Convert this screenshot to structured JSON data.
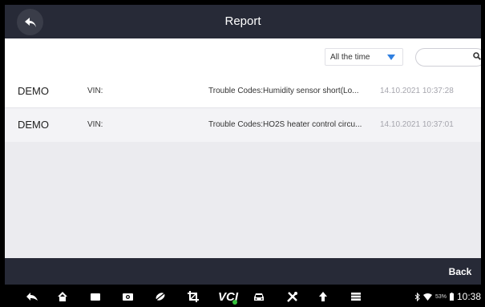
{
  "header": {
    "title": "Report"
  },
  "filter": {
    "period_selected": "All the time",
    "search_value": ""
  },
  "reports": [
    {
      "name": "DEMO",
      "vin": "VIN:",
      "codes": "Trouble Codes:Humidity sensor short(Lo...",
      "date": "14.10.2021 10:37:28"
    },
    {
      "name": "DEMO",
      "vin": "VIN:",
      "codes": "Trouble Codes:HO2S heater control circu...",
      "date": "14.10.2021 10:37:01"
    }
  ],
  "footer": {
    "back_label": "Back"
  },
  "system_bar": {
    "vci_label": "VCI",
    "battery_percent": "53%",
    "time": "10:38",
    "icons": [
      "back-icon",
      "home-icon",
      "recent-apps-icon",
      "camera-icon",
      "browser-icon",
      "crop-icon",
      "vci-icon",
      "car-icon",
      "tools-icon",
      "upload-icon",
      "menu-icon",
      "bluetooth-icon",
      "wifi-icon",
      "battery-icon"
    ]
  },
  "colors": {
    "header_bg": "#272a37",
    "accent_blue": "#2f7fe0",
    "vci_green": "#35c23b"
  }
}
